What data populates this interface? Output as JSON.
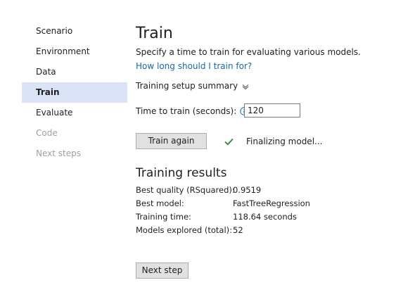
{
  "sidebar": {
    "items": [
      {
        "label": "Scenario",
        "state": "normal"
      },
      {
        "label": "Environment",
        "state": "normal"
      },
      {
        "label": "Data",
        "state": "normal"
      },
      {
        "label": "Train",
        "state": "active"
      },
      {
        "label": "Evaluate",
        "state": "normal"
      },
      {
        "label": "Code",
        "state": "disabled"
      },
      {
        "label": "Next steps",
        "state": "disabled"
      }
    ]
  },
  "main": {
    "title": "Train",
    "subtitle": "Specify a time to train for evaluating various models.",
    "help_link": "How long should I train for?",
    "summary_toggle": "Training setup summary",
    "time_label": "Time to train (seconds):",
    "time_value": "120",
    "train_again_label": "Train again",
    "status_text": "Finalizing model...",
    "results_heading": "Training results",
    "results": [
      {
        "label": "Best quality (RSquared):",
        "value": "0.9519"
      },
      {
        "label": "Best model:",
        "value": "FastTreeRegression"
      },
      {
        "label": "Training time:",
        "value": "118.64 seconds"
      },
      {
        "label": "Models explored (total):",
        "value": "52"
      }
    ],
    "next_step_label": "Next step"
  },
  "colors": {
    "accent": "#1a66b3",
    "active_nav_bg": "#dbe3f7",
    "success": "#2e8b3a",
    "disabled_text": "#a0a0a0"
  },
  "icons": {
    "summary_toggle": "chevron-down-icon",
    "time_info": "info-icon",
    "status": "checkmark-icon"
  }
}
